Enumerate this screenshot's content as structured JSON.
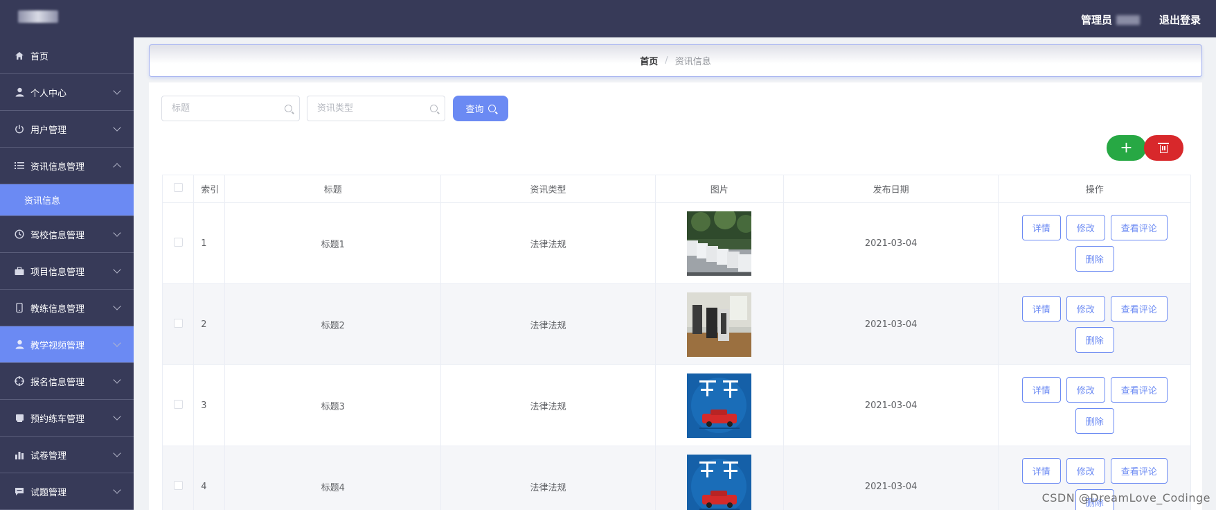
{
  "header": {
    "logo_text": "▬",
    "admin_label": "管理员",
    "logout_label": "退出登录"
  },
  "sidebar": {
    "items": [
      {
        "label": "首页",
        "icon": "home-icon"
      },
      {
        "label": "个人中心",
        "icon": "user-icon"
      },
      {
        "label": "用户管理",
        "icon": "power-icon"
      },
      {
        "label": "资讯信息管理",
        "icon": "list-icon"
      },
      {
        "label": "驾校信息管理",
        "icon": "clock-icon"
      },
      {
        "label": "项目信息管理",
        "icon": "briefcase-icon"
      },
      {
        "label": "教练信息管理",
        "icon": "phone-icon"
      },
      {
        "label": "教学视频管理",
        "icon": "user-icon"
      },
      {
        "label": "报名信息管理",
        "icon": "target-icon"
      },
      {
        "label": "预约练车管理",
        "icon": "card-icon"
      },
      {
        "label": "试卷管理",
        "icon": "chart-icon"
      },
      {
        "label": "试题管理",
        "icon": "message-icon"
      }
    ],
    "sub_item_label": "资讯信息"
  },
  "breadcrumb": {
    "home": "首页",
    "separator": "/",
    "current": "资讯信息"
  },
  "search": {
    "title_placeholder": "标题",
    "type_placeholder": "资讯类型",
    "query_label": "查询"
  },
  "toolbar": {
    "add_label": "+"
  },
  "table": {
    "columns": [
      "索引",
      "标题",
      "资讯类型",
      "图片",
      "发布日期",
      "操作"
    ],
    "rows": [
      {
        "index": "1",
        "title": "标题1",
        "type": "法律法规",
        "date": "2021-03-04"
      },
      {
        "index": "2",
        "title": "标题2",
        "type": "法律法规",
        "date": "2021-03-04"
      },
      {
        "index": "3",
        "title": "标题3",
        "type": "法律法规",
        "date": "2021-03-04"
      },
      {
        "index": "4",
        "title": "标题4",
        "type": "法律法规",
        "date": "2021-03-04"
      }
    ],
    "actions": {
      "detail": "详情",
      "edit": "修改",
      "comments": "查看评论",
      "delete": "删除"
    }
  },
  "watermark": "CSDN @DreamLove_Codinge",
  "colors": {
    "sidebar_bg": "#373a58",
    "accent": "#6b8af3",
    "add_green": "#27a844",
    "delete_red": "#d8282b"
  }
}
